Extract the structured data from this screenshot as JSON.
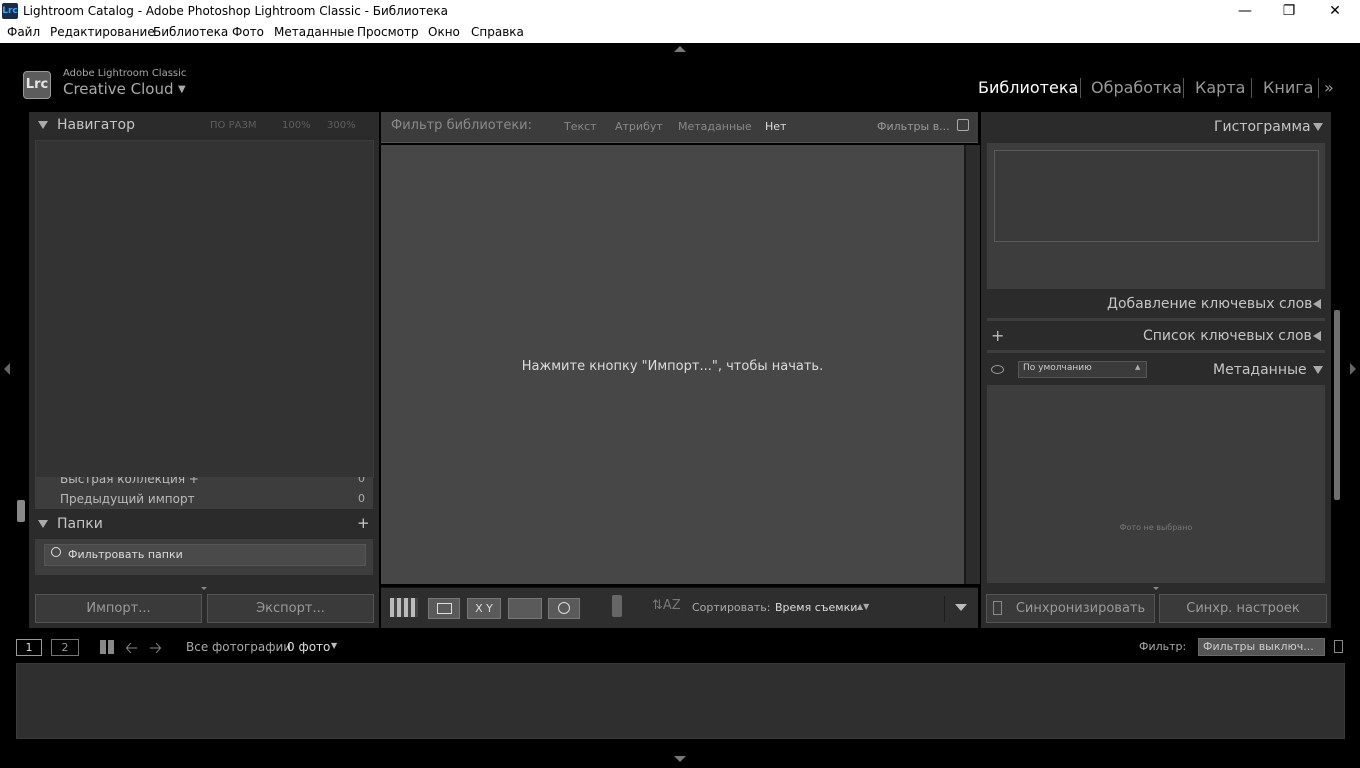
{
  "window": {
    "app_icon": "Lrc",
    "title": "Lightroom Catalog - Adobe Photoshop Lightroom Classic - Библиотека"
  },
  "menu": [
    "Файл",
    "Редактирование",
    "Библиотека",
    "Фото",
    "Метаданные",
    "Просмотр",
    "Окно",
    "Справка"
  ],
  "identity": {
    "logo": "Lrc",
    "small_text": "Adobe Lightroom Classic",
    "big_text": "Creative Cloud"
  },
  "modules": [
    "Библиотека",
    "Обработка",
    "Карта",
    "Книга"
  ],
  "modules_more": "»",
  "left_panel": {
    "navigator": {
      "title": "Навигатор",
      "zoom_fit": "ПО РАЗМ",
      "zoom_100": "100%",
      "zoom_300": "300%"
    },
    "catalog_items": [
      {
        "label": "Быстрая коллекция +",
        "count": "0"
      },
      {
        "label": "Предыдущий импорт",
        "count": "0"
      }
    ],
    "folders": {
      "title": "Папки",
      "add": "+",
      "filter_placeholder": "Фильтровать папки"
    },
    "import_button": "Импорт...",
    "export_button": "Экспорт..."
  },
  "filter_bar": {
    "label": "Фильтр библиотеки:",
    "text": "Текст",
    "attribute": "Атрибут",
    "metadata": "Метаданные",
    "none": "Нет",
    "filters_menu": "Фильтры в..."
  },
  "center": {
    "empty_message": "Нажмите кнопку \"Импорт...\", чтобы начать."
  },
  "toolbar": {
    "sort_label": "Сортировать:",
    "sort_value": "Время съемки",
    "compare_label": "X Y"
  },
  "right_panel": {
    "histogram": "Гистограмма",
    "keywording": "Добавление ключевых слов",
    "keyword_list": "Список ключевых слов",
    "keyword_add": "+",
    "metadata": "Метаданные",
    "metadata_preset": "По умолчанию",
    "no_photo": "Фото не выбрано",
    "sync": "Синхронизировать",
    "sync_settings": "Синхр. настроек"
  },
  "filmstrip": {
    "monitor1": "1",
    "monitor2": "2",
    "source": "Все фотографии",
    "count": "0 фото",
    "filter_label": "Фильтр:",
    "filter_value": "Фильтры выключ..."
  },
  "colors": {
    "background": "#000000",
    "panel": "#2b2b2b",
    "center": "#474747",
    "active_module": "#ffffff"
  }
}
